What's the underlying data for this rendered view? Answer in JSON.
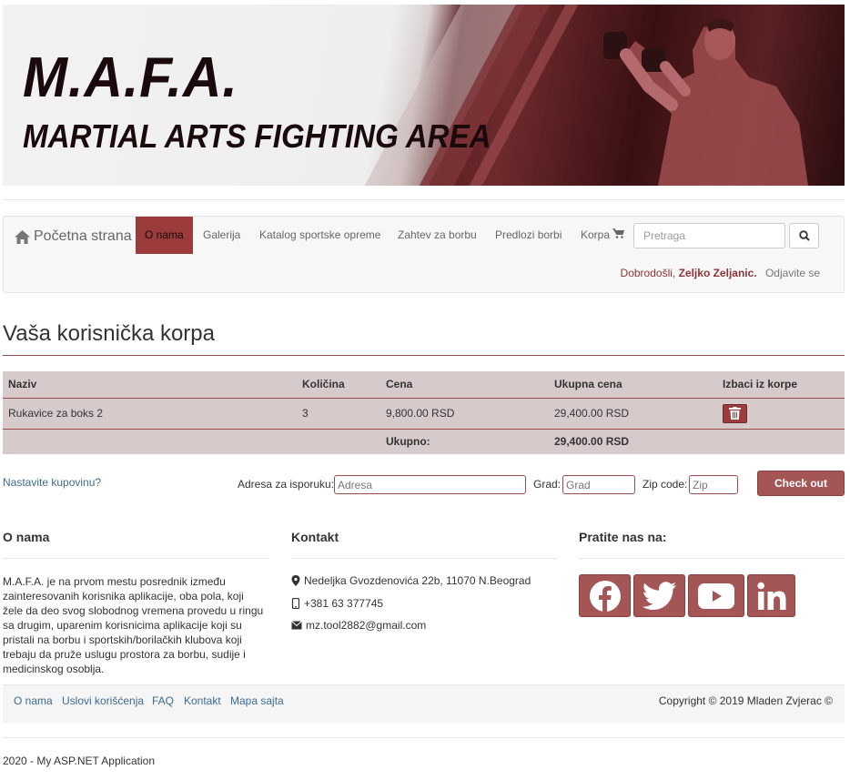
{
  "banner": {
    "logo_line1": "M.A.F.A.",
    "logo_line2": "MARTIAL ARTS FIGHTING AREA"
  },
  "nav": {
    "brand_icon": "home-icon",
    "brand": "Početna strana",
    "items": [
      {
        "label": "O nama",
        "active": true
      },
      {
        "label": "Galerija"
      },
      {
        "label": "Katalog sportske opreme"
      },
      {
        "label": "Zahtev za borbu"
      },
      {
        "label": "Predlozi borbi"
      },
      {
        "label": "Korpa",
        "icon": "cart-icon"
      }
    ],
    "search_placeholder": "Pretraga",
    "search_icon": "search-icon",
    "welcome": "Dobrodošli,",
    "user": "Zeljko Zeljanic.",
    "logout": "Odjavite se"
  },
  "cart": {
    "title": "Vaša korisnička korpa",
    "columns": [
      "Naziv",
      "Količina",
      "Cena",
      "Ukupna cena",
      "Izbaci iz korpe"
    ],
    "rows": [
      {
        "name": "Rukavice za boks 2",
        "qty": "3",
        "price": "9,800.00 RSD",
        "total": "29,400.00 RSD",
        "remove_icon": "trash-icon"
      }
    ],
    "total_label": "Ukupno:",
    "total_value": "29,400.00 RSD"
  },
  "checkout": {
    "continue": "Nastavite kupovinu?",
    "address_label": "Adresa za isporuku:",
    "address_placeholder": "Adresa",
    "city_label": "Grad:",
    "city_placeholder": "Grad",
    "zip_label": "Zip code:",
    "zip_placeholder": "Zip",
    "button": "Check out"
  },
  "footer": {
    "about_title": "O nama",
    "about_text": "M.A.F.A. je na prvom mestu posrednik između zainteresovanih korisnika aplikacije, oba pola, koji žele da deo svog slobodnog vremena provedu u ringu sa drugim, uparenim korisnicima aplikacije koji su pristali na borbu i sportskih/borilačkih klubova koji trebaju da pruže uslugu prostora za borbu, sudije i medicinskog osoblja.",
    "contact_title": "Kontakt",
    "address": "Nedeljka Gvozdenovića 22b, 11070 N.Beograd",
    "phone": "+381 63 377745",
    "email": "mz.tool2882@gmail.com",
    "follow_title": "Pratite nas na:",
    "social": [
      "facebook-icon",
      "twitter-icon",
      "youtube-icon",
      "linkedin-icon"
    ],
    "links": [
      "O nama",
      "Uslovi korišćenja",
      "FAQ",
      "Kontakt",
      "Mapa sajta"
    ],
    "copyright": "Copyright © 2019 Mladen Zvjerac ©",
    "app": "2020 - My ASP.NET Application"
  },
  "colors": {
    "accent": "#9b3b3c",
    "button": "#a45556",
    "table_bg": "#d7cacb",
    "link": "#3c6b8f"
  }
}
